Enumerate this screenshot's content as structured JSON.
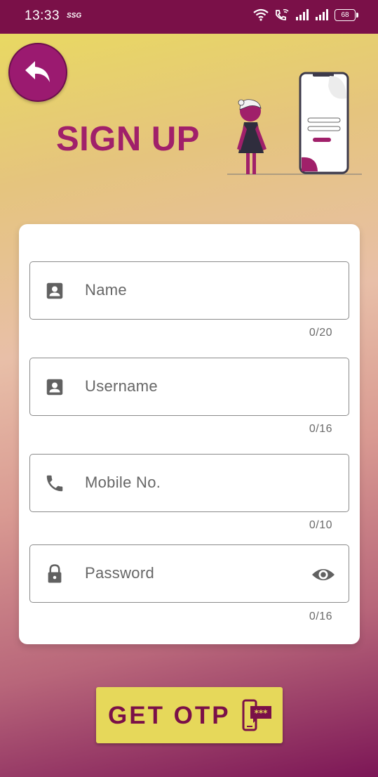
{
  "status_bar": {
    "time": "13:33",
    "carrier_tag": "SSG",
    "battery": "68",
    "icons": [
      "wifi-icon",
      "wifi-call-icon",
      "signal-icon",
      "signal-icon",
      "battery-icon"
    ]
  },
  "header": {
    "back_icon": "reply-arrow-icon",
    "title": "SIGN UP"
  },
  "form": {
    "fields": [
      {
        "label": "Name",
        "icon": "account-box-icon",
        "counter": "0/20"
      },
      {
        "label": "Username",
        "icon": "account-box-icon",
        "counter": "0/16"
      },
      {
        "label": "Mobile No.",
        "icon": "phone-icon",
        "counter": "0/10"
      },
      {
        "label": "Password",
        "icon": "lock-icon",
        "counter": "0/16",
        "trailing_icon": "eye-icon"
      }
    ]
  },
  "action": {
    "label": "GET OTP",
    "icon": "otp-message-icon"
  },
  "colors": {
    "status_bar": "#7a1048",
    "accent": "#a0206a",
    "button_bg": "#e6d85a",
    "button_text": "#7a1048"
  }
}
